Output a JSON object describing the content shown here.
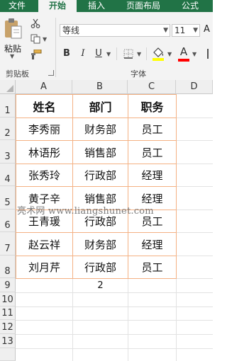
{
  "tabs": [
    {
      "label": "文件",
      "active": false
    },
    {
      "label": "开始",
      "active": true
    },
    {
      "label": "插入",
      "active": false
    },
    {
      "label": "页面布局",
      "active": false
    },
    {
      "label": "公式",
      "active": false
    }
  ],
  "clipboard": {
    "paste_label": "粘贴",
    "group_label": "剪贴板"
  },
  "font": {
    "family": "等线",
    "size": "11",
    "bold": "B",
    "italic": "I",
    "underline": "U",
    "font_color_glyph": "A",
    "group_label": "字体",
    "highlight_color": "#ffff00",
    "font_color": "#ff0000"
  },
  "columns": [
    "A",
    "B",
    "C",
    "D"
  ],
  "rows": [
    "1",
    "2",
    "3",
    "4",
    "5",
    "6",
    "7",
    "8",
    "9",
    "10",
    "11",
    "12",
    "13"
  ],
  "table": {
    "headers": [
      "姓名",
      "部门",
      "职务"
    ],
    "rows": [
      [
        "李秀丽",
        "财务部",
        "员工"
      ],
      [
        "林语彤",
        "销售部",
        "员工"
      ],
      [
        "张秀玲",
        "行政部",
        "经理"
      ],
      [
        "黄子辛",
        "销售部",
        "经理"
      ],
      [
        "王青瑗",
        "行政部",
        "员工"
      ],
      [
        "赵云祥",
        "财务部",
        "经理"
      ],
      [
        "刘月芹",
        "行政部",
        "员工"
      ]
    ],
    "border_color": "#f4b183"
  },
  "b9_value": "2",
  "watermark": "亮术网 www.liangshunet.com",
  "theme": {
    "accent": "#217346"
  }
}
